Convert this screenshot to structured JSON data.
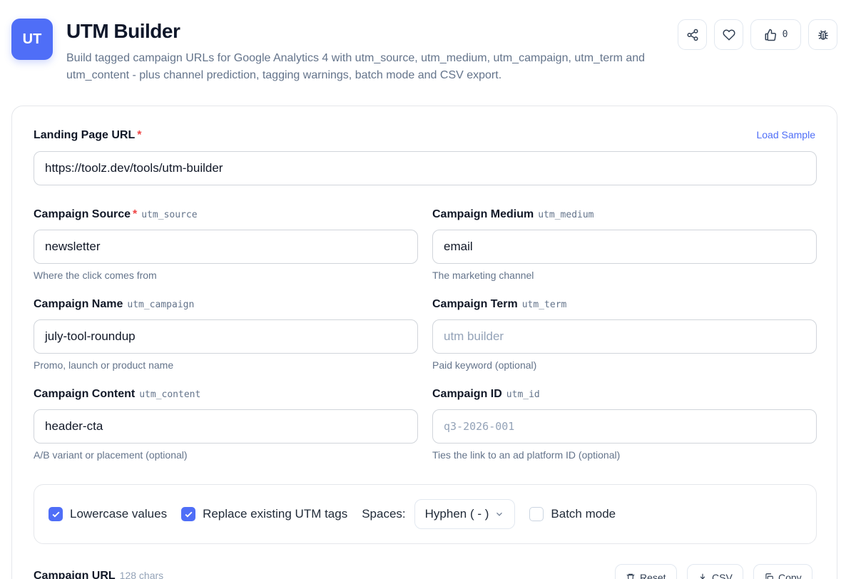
{
  "header": {
    "logo_text": "UT",
    "title": "UTM Builder",
    "subtitle": "Build tagged campaign URLs for Google Analytics 4 with utm_source, utm_medium, utm_campaign, utm_term and utm_content - plus channel prediction, tagging warnings, batch mode and CSV export.",
    "like_count": "0"
  },
  "form": {
    "load_sample": "Load Sample",
    "landing": {
      "label": "Landing Page URL",
      "required": "*",
      "value": "https://toolz.dev/tools/utm-builder"
    },
    "source": {
      "label": "Campaign Source",
      "required": "*",
      "param": "utm_source",
      "value": "newsletter",
      "hint": "Where the click comes from"
    },
    "medium": {
      "label": "Campaign Medium",
      "param": "utm_medium",
      "value": "email",
      "hint": "The marketing channel"
    },
    "name": {
      "label": "Campaign Name",
      "param": "utm_campaign",
      "value": "july-tool-roundup",
      "hint": "Promo, launch or product name"
    },
    "term": {
      "label": "Campaign Term",
      "param": "utm_term",
      "placeholder": "utm builder",
      "hint": "Paid keyword (optional)"
    },
    "content": {
      "label": "Campaign Content",
      "param": "utm_content",
      "value": "header-cta",
      "hint": "A/B variant or placement (optional)"
    },
    "id": {
      "label": "Campaign ID",
      "param": "utm_id",
      "placeholder": "q3-2026-001",
      "hint": "Ties the link to an ad platform ID (optional)"
    }
  },
  "options": {
    "lowercase": {
      "label": "Lowercase values",
      "checked": true
    },
    "replace": {
      "label": "Replace existing UTM tags",
      "checked": true
    },
    "spaces_label": "Spaces:",
    "spaces_value": "Hyphen ( - )",
    "batch": {
      "label": "Batch mode",
      "checked": false
    }
  },
  "output": {
    "label": "Campaign URL",
    "chars": "128 chars",
    "reset": "Reset",
    "csv": "CSV",
    "copy": "Copy"
  },
  "colors": {
    "accent": "#4f6ef7",
    "required": "#ef4444",
    "muted": "#64748b"
  }
}
